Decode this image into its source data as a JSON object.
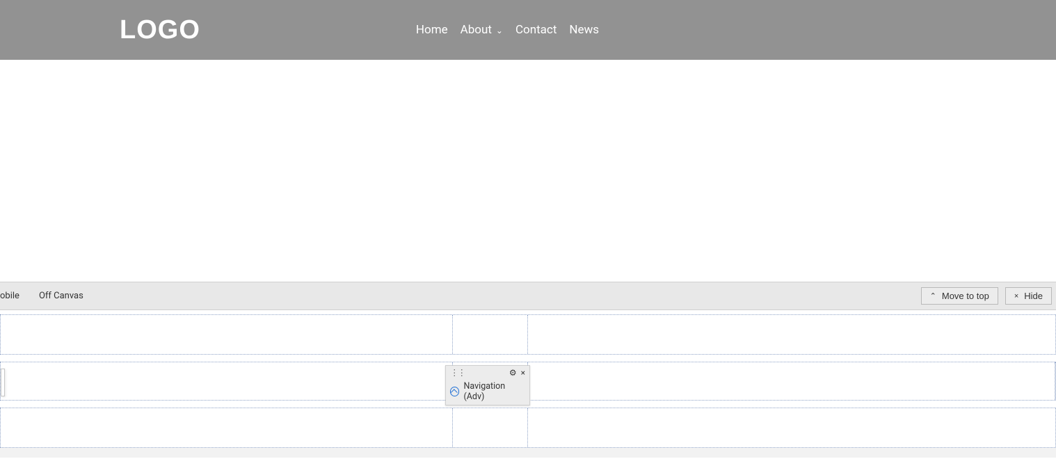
{
  "header": {
    "logo_text": "LOGO",
    "nav": [
      {
        "label": "Home"
      },
      {
        "label": "About",
        "has_submenu": true
      },
      {
        "label": "Contact"
      },
      {
        "label": "News"
      }
    ]
  },
  "breakpoint_bar": {
    "items_left": [
      {
        "label": "obile"
      },
      {
        "label": "Off Canvas"
      }
    ],
    "move_to_top_label": "Move to top",
    "hide_label": "Hide"
  },
  "element_popover": {
    "label": "Navigation (Adv)"
  }
}
